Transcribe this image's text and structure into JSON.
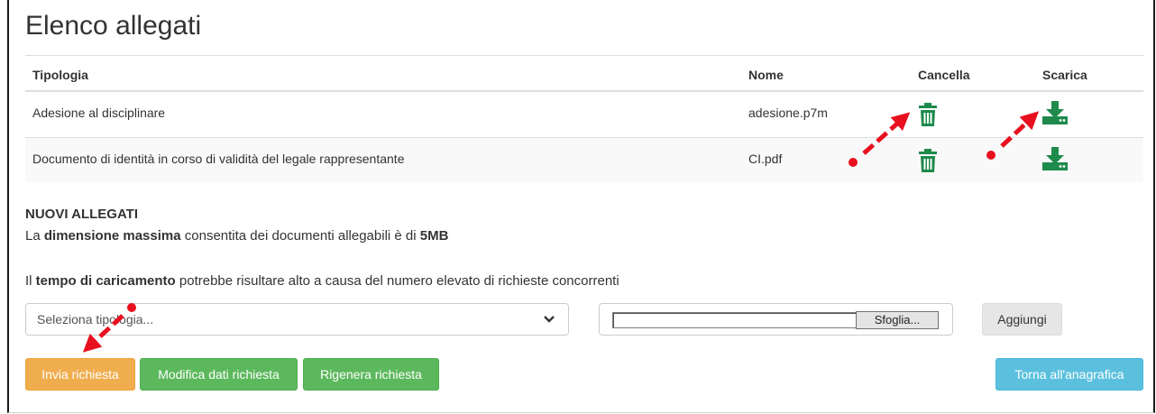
{
  "page_title": "Elenco allegati",
  "table": {
    "headers": {
      "tipologia": "Tipologia",
      "nome": "Nome",
      "cancella": "Cancella",
      "scarica": "Scarica"
    },
    "rows": [
      {
        "tipologia": "Adesione al disciplinare",
        "nome": "adesione.p7m"
      },
      {
        "tipologia": "Documento di identità in corso di validità del legale rappresentante",
        "nome": "CI.pdf"
      }
    ]
  },
  "nuovi_allegati": {
    "title": "NUOVI ALLEGATI",
    "line1": {
      "pre": "La ",
      "bold1": "dimensione massima",
      "mid": " consentita dei documenti allegabili è di ",
      "bold2": "5MB"
    },
    "line2": {
      "pre": "Il ",
      "bold": "tempo di caricamento",
      "post": " potrebbe risultare alto a causa del numero elevato di richieste concorrenti"
    }
  },
  "form": {
    "select_value": "Seleziona tipologia...",
    "browse_label": "Sfoglia...",
    "add_label": "Aggiungi"
  },
  "buttons": {
    "send": "Invia richiesta",
    "modify": "Modifica dati richiesta",
    "regenerate": "Rigenera richiesta",
    "back": "Torna all'anagrafica"
  },
  "icons": {
    "delete": "trash-icon",
    "download": "download-icon",
    "dropdown": "chevron-down-icon",
    "annotation": "red-arrow-icon"
  },
  "colors": {
    "icon_green": "#1e8a4c",
    "annotation_red": "#e8101e",
    "btn_orange": "#f0ad4e",
    "btn_green": "#5cb85c",
    "btn_blue": "#5bc0de"
  }
}
